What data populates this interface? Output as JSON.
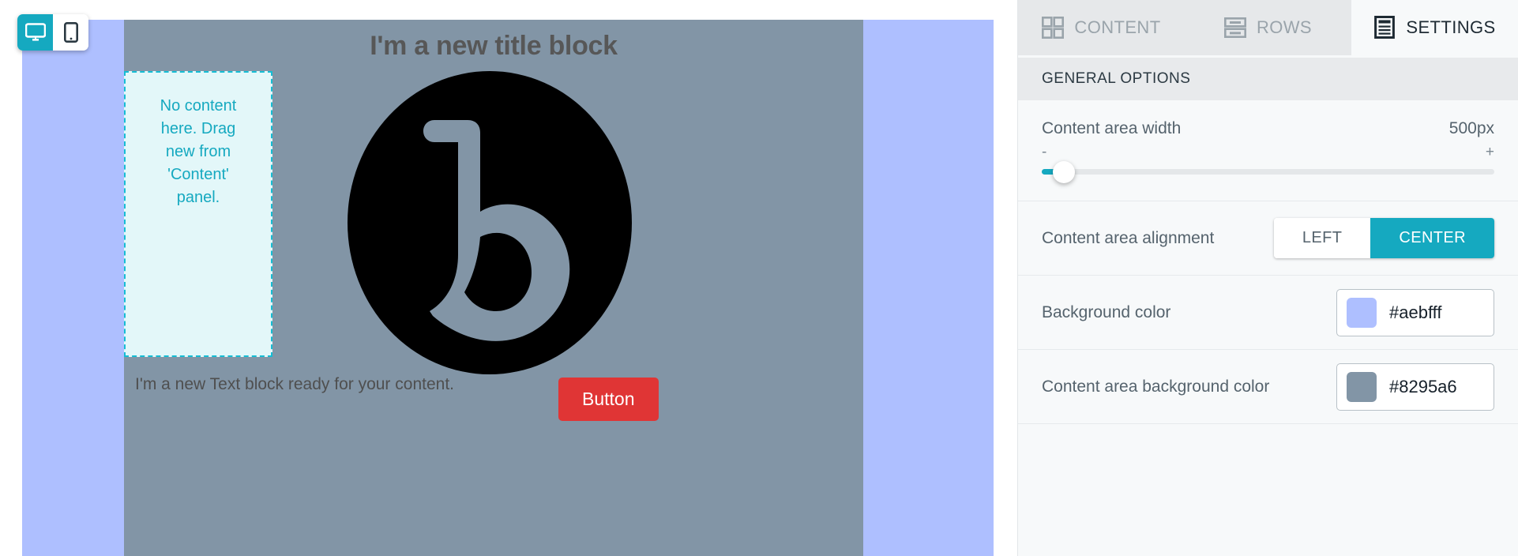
{
  "device_toggle": {
    "desktop_label": "desktop-view",
    "mobile_label": "mobile-view"
  },
  "canvas": {
    "title_block": "I'm a new title block",
    "dropzone_text": "No content here. Drag new from 'Content' panel.",
    "text_block": "I'm a new Text block ready for your content.",
    "button_label": "Button",
    "background_color": "#aebfff",
    "content_area_color": "#8295a6",
    "button_color": "#e03535",
    "dropzone_border_color": "#15bdd4",
    "dropzone_fill_color": "#e3f7f9"
  },
  "panel": {
    "tabs": [
      {
        "label": "CONTENT",
        "icon": "grid-icon",
        "active": false
      },
      {
        "label": "ROWS",
        "icon": "rows-icon",
        "active": false
      },
      {
        "label": "SETTINGS",
        "icon": "settings-document-icon",
        "active": true
      }
    ],
    "section_title": "GENERAL OPTIONS",
    "content_area_width": {
      "label": "Content area width",
      "value": "500px",
      "minus": "-",
      "plus": "+"
    },
    "content_area_alignment": {
      "label": "Content area alignment",
      "options": [
        {
          "label": "LEFT",
          "active": false
        },
        {
          "label": "CENTER",
          "active": true
        }
      ]
    },
    "background_color": {
      "label": "Background color",
      "value": "#aebfff"
    },
    "content_area_background_color": {
      "label": "Content area background color",
      "value": "#8295a6"
    }
  }
}
